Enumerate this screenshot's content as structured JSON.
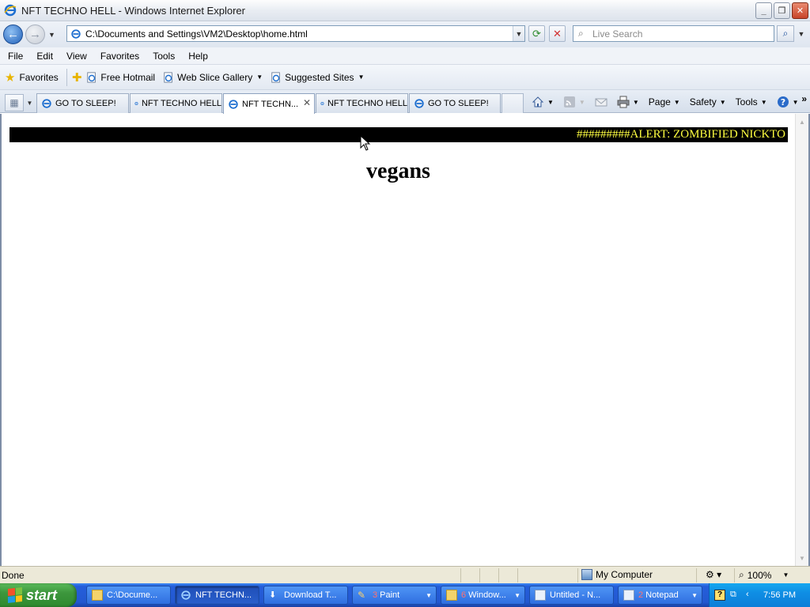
{
  "window": {
    "title": "NFT TECHNO HELL - Windows Internet Explorer",
    "min_label": "_",
    "restore_label": "❐",
    "close_label": "✕"
  },
  "address_bar": {
    "url": "C:\\Documents and Settings\\VM2\\Desktop\\home.html",
    "search_placeholder": "Live Search"
  },
  "menu": {
    "items": [
      "File",
      "Edit",
      "View",
      "Favorites",
      "Tools",
      "Help"
    ]
  },
  "favorites_bar": {
    "favorites_label": "Favorites",
    "links": [
      "Free Hotmail",
      "Web Slice Gallery",
      "Suggested Sites"
    ]
  },
  "tabs": [
    {
      "label": "GO TO SLEEP!"
    },
    {
      "label": "NFT TECHNO HELL"
    },
    {
      "label": "NFT TECHN...",
      "active": true
    },
    {
      "label": "NFT TECHNO HELL"
    },
    {
      "label": "GO TO SLEEP!"
    }
  ],
  "command_bar": {
    "page_label": "Page",
    "safety_label": "Safety",
    "tools_label": "Tools"
  },
  "page": {
    "marquee_text": "#########ALERT: ZOMBIFIED NICKTO",
    "heading": "vegans"
  },
  "status_bar": {
    "status": "Done",
    "zone": "My Computer",
    "zoom": "100%"
  },
  "taskbar": {
    "start_label": "start",
    "items": [
      {
        "label": "C:\\Docume...",
        "count": ""
      },
      {
        "label": "NFT TECHN...",
        "count": "",
        "active": true
      },
      {
        "label": "Download T...",
        "count": ""
      },
      {
        "label": "Paint",
        "count": "3"
      },
      {
        "label": "Window...",
        "count": "6"
      },
      {
        "label": "Untitled - N...",
        "count": ""
      },
      {
        "label": "Notepad",
        "count": "2"
      }
    ],
    "clock": "7:56 PM"
  },
  "colors": {
    "marquee_bg": "#000000",
    "marquee_text": "#ffff40",
    "taskbar_blue": "#245edb",
    "start_green": "#3d963d"
  }
}
